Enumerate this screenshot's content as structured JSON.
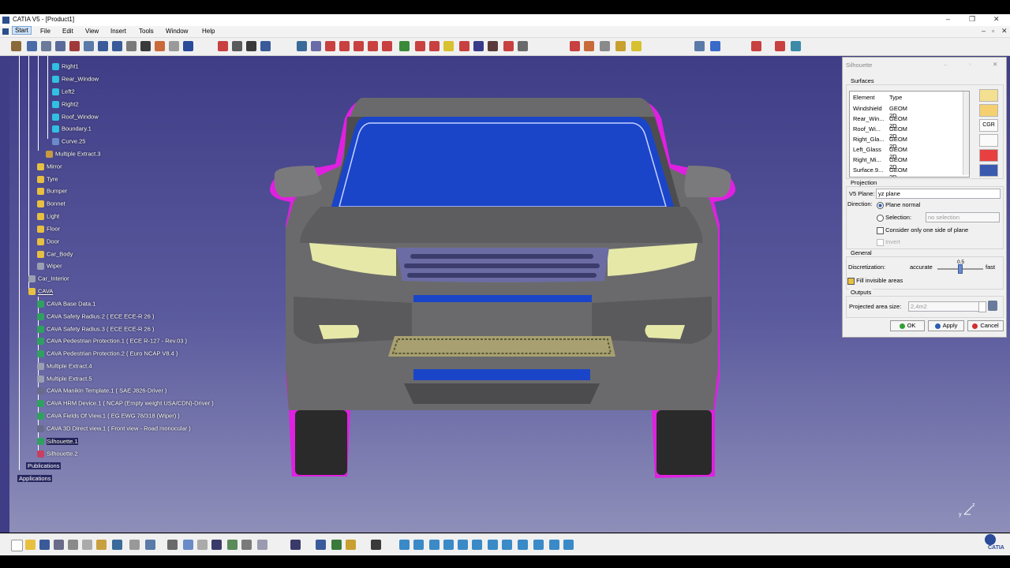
{
  "window": {
    "title": "CATIA V5 - [Product1]",
    "controls": [
      "–",
      "❐",
      "✕"
    ],
    "doc_controls": [
      "–",
      "▫",
      "✕"
    ]
  },
  "menu": [
    "Start",
    "File",
    "Edit",
    "View",
    "Insert",
    "Tools",
    "Window",
    "Help"
  ],
  "tree": {
    "sketch_nodes": [
      "Right1",
      "Rear_Window",
      "Left2",
      "Right2",
      "Roof_Window",
      "Boundary.1",
      "Curve.25"
    ],
    "multi_extract": "Multiple Extract.3",
    "sets": [
      "Mirror",
      "Tyre",
      "Bumper",
      "Bonnet",
      "Light",
      "Floor",
      "Door",
      "Car_Body",
      "Wiper"
    ],
    "car_interior": "Car_Interior",
    "cava": "CAVA",
    "cava_children": [
      "CAVA Base Data.1",
      "CAVA Safety Radius.2 ( ECE ECE-R 26 )",
      "CAVA Safety Radius.3 ( ECE ECE-R 26 )",
      "CAVA Pedestrian Protection.1 ( ECE R-127 - Rev.03 )",
      "CAVA Pedestrian Protection.2 ( Euro NCAP V8.4 )",
      "Multiple Extract.4",
      "Multiple Extract.5",
      "CAVA Manikin Template.1 ( SAE J826-Driver )",
      "CAVA HRM Device.1 ( NCAP (Empty weight USA/CDN)-Driver )",
      "CAVA Fields Of View.1 ( EG EWG 78/318 (Wiper) )",
      "CAVA 3D Direct view.1 ( Front view - Road monocular )",
      "Silhouette.1",
      "Silhouette.2"
    ],
    "publications": "Publications",
    "applications": "Applications"
  },
  "dialog": {
    "title": "Silhouette",
    "surfaces_label": "Surfaces",
    "col_element": "Element",
    "col_type": "Type",
    "rows": [
      {
        "element": "Windshield",
        "type": "GEOM 2D"
      },
      {
        "element": "Rear_Win...",
        "type": "GEOM 2D"
      },
      {
        "element": "Roof_Wi...",
        "type": "GEOM 2D"
      },
      {
        "element": "Right_Gla...",
        "type": "GEOM 2D"
      },
      {
        "element": "Left_Glass",
        "type": "GEOM 2D"
      },
      {
        "element": "Right_Mi...",
        "type": "GEOM 2D"
      },
      {
        "element": "Surface.9...",
        "type": "GEOM 2D"
      }
    ],
    "cgr_label": "CGR",
    "projection_label": "Projection",
    "v5_plane_label": "V5 Plane:",
    "v5_plane_value": "yz plane",
    "direction_label": "Direction:",
    "plane_normal": "Plane normal",
    "selection_label": "Selection:",
    "selection_value": "no selection",
    "one_side": "Consider only one side of plane",
    "invert": "Invert",
    "general_label": "General",
    "discretization_label": "Discretization:",
    "accurate": "accurate",
    "fast": "fast",
    "slider_value": "0.5",
    "fill_invisible": "Fill invisible areas",
    "outputs_label": "Outputs",
    "projected_area_label": "Projected area size:",
    "projected_area_value": "2,4m2",
    "ok": "OK",
    "apply": "Apply",
    "cancel": "Cancel"
  },
  "axis": {
    "z": "z",
    "y": "y"
  },
  "brand": "CATIA",
  "colors": {
    "silhouette": "#e020e0",
    "glass": "#1a45c8",
    "viewport_top": "#3f3d86",
    "lights": "#e6e8a8"
  }
}
